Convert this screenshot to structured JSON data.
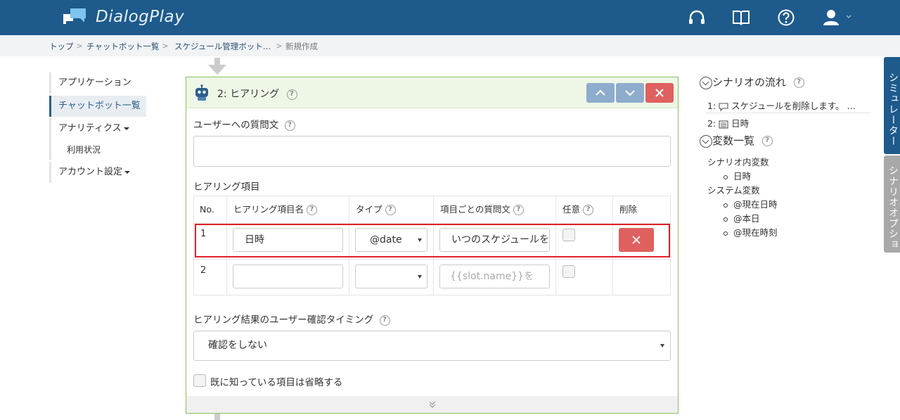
{
  "app": {
    "name": "DialogPlay"
  },
  "header_icons": [
    "headset-icon",
    "book-icon",
    "help-icon",
    "user-icon"
  ],
  "breadcrumb": {
    "items": [
      "トップ",
      "チャットボット一覧",
      "スケジュール管理ボット…",
      "新規作成"
    ],
    "separator": ">"
  },
  "nav": {
    "items": [
      {
        "label": "アプリケーション"
      },
      {
        "label": "チャットボット一覧"
      },
      {
        "label": "アナリティクス"
      },
      {
        "label": "利用状況"
      },
      {
        "label": "アカウント設定"
      }
    ]
  },
  "panel": {
    "title": "2: ヒアリング",
    "question_label": "ユーザーへの質問文",
    "question_value": "",
    "items_label": "ヒアリング項目",
    "table": {
      "headers": [
        "No.",
        "ヒアリング項目名",
        "タイプ",
        "項目ごとの質問文",
        "任意",
        "削除"
      ],
      "rows": [
        {
          "no": "1",
          "name": "日時",
          "type": "@date",
          "question": "いつのスケジュールを削除しますか？",
          "question_placeholder": "",
          "optional": false
        },
        {
          "no": "2",
          "name": "",
          "type": "",
          "question": "",
          "question_placeholder": "{{slot.name}}を",
          "optional": false
        }
      ]
    },
    "confirm_label": "ヒアリング結果のユーザー確認タイミング",
    "confirm_value": "確認をしない",
    "skip_label": "既に知っている項目は省略する",
    "skip_checked": false
  },
  "scenario": {
    "title": "シナリオの流れ",
    "steps": [
      {
        "label": "1:",
        "text": "スケジュールを削除します。 …"
      },
      {
        "label": "2:",
        "text": "日時"
      }
    ]
  },
  "variables": {
    "title": "変数一覧",
    "groups": [
      {
        "label": "シナリオ内変数",
        "items": [
          "日時"
        ]
      },
      {
        "label": "システム変数",
        "items": [
          "@現在日時",
          "@本日",
          "@現在時刻"
        ]
      }
    ]
  },
  "side_tabs": [
    "シミュレーター",
    "シナリオオプション"
  ],
  "colors": {
    "primary": "#1e5a8c",
    "danger": "#e06060",
    "panel_border": "#8cbf5f",
    "highlight": "#e0202a"
  }
}
